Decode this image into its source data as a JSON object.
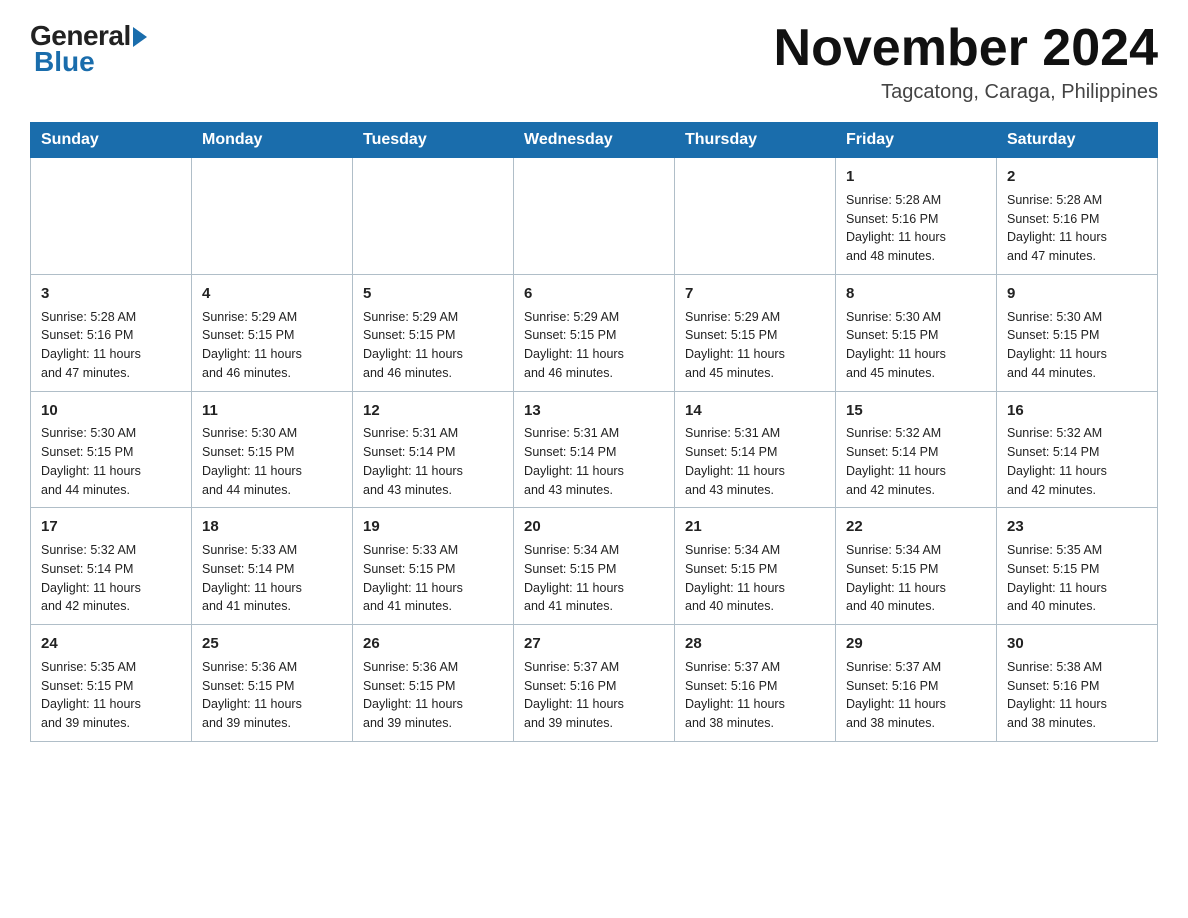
{
  "header": {
    "logo_general": "General",
    "logo_blue": "Blue",
    "month_title": "November 2024",
    "location": "Tagcatong, Caraga, Philippines"
  },
  "weekdays": [
    "Sunday",
    "Monday",
    "Tuesday",
    "Wednesday",
    "Thursday",
    "Friday",
    "Saturday"
  ],
  "weeks": [
    [
      {
        "day": "",
        "info": ""
      },
      {
        "day": "",
        "info": ""
      },
      {
        "day": "",
        "info": ""
      },
      {
        "day": "",
        "info": ""
      },
      {
        "day": "",
        "info": ""
      },
      {
        "day": "1",
        "info": "Sunrise: 5:28 AM\nSunset: 5:16 PM\nDaylight: 11 hours\nand 48 minutes."
      },
      {
        "day": "2",
        "info": "Sunrise: 5:28 AM\nSunset: 5:16 PM\nDaylight: 11 hours\nand 47 minutes."
      }
    ],
    [
      {
        "day": "3",
        "info": "Sunrise: 5:28 AM\nSunset: 5:16 PM\nDaylight: 11 hours\nand 47 minutes."
      },
      {
        "day": "4",
        "info": "Sunrise: 5:29 AM\nSunset: 5:15 PM\nDaylight: 11 hours\nand 46 minutes."
      },
      {
        "day": "5",
        "info": "Sunrise: 5:29 AM\nSunset: 5:15 PM\nDaylight: 11 hours\nand 46 minutes."
      },
      {
        "day": "6",
        "info": "Sunrise: 5:29 AM\nSunset: 5:15 PM\nDaylight: 11 hours\nand 46 minutes."
      },
      {
        "day": "7",
        "info": "Sunrise: 5:29 AM\nSunset: 5:15 PM\nDaylight: 11 hours\nand 45 minutes."
      },
      {
        "day": "8",
        "info": "Sunrise: 5:30 AM\nSunset: 5:15 PM\nDaylight: 11 hours\nand 45 minutes."
      },
      {
        "day": "9",
        "info": "Sunrise: 5:30 AM\nSunset: 5:15 PM\nDaylight: 11 hours\nand 44 minutes."
      }
    ],
    [
      {
        "day": "10",
        "info": "Sunrise: 5:30 AM\nSunset: 5:15 PM\nDaylight: 11 hours\nand 44 minutes."
      },
      {
        "day": "11",
        "info": "Sunrise: 5:30 AM\nSunset: 5:15 PM\nDaylight: 11 hours\nand 44 minutes."
      },
      {
        "day": "12",
        "info": "Sunrise: 5:31 AM\nSunset: 5:14 PM\nDaylight: 11 hours\nand 43 minutes."
      },
      {
        "day": "13",
        "info": "Sunrise: 5:31 AM\nSunset: 5:14 PM\nDaylight: 11 hours\nand 43 minutes."
      },
      {
        "day": "14",
        "info": "Sunrise: 5:31 AM\nSunset: 5:14 PM\nDaylight: 11 hours\nand 43 minutes."
      },
      {
        "day": "15",
        "info": "Sunrise: 5:32 AM\nSunset: 5:14 PM\nDaylight: 11 hours\nand 42 minutes."
      },
      {
        "day": "16",
        "info": "Sunrise: 5:32 AM\nSunset: 5:14 PM\nDaylight: 11 hours\nand 42 minutes."
      }
    ],
    [
      {
        "day": "17",
        "info": "Sunrise: 5:32 AM\nSunset: 5:14 PM\nDaylight: 11 hours\nand 42 minutes."
      },
      {
        "day": "18",
        "info": "Sunrise: 5:33 AM\nSunset: 5:14 PM\nDaylight: 11 hours\nand 41 minutes."
      },
      {
        "day": "19",
        "info": "Sunrise: 5:33 AM\nSunset: 5:15 PM\nDaylight: 11 hours\nand 41 minutes."
      },
      {
        "day": "20",
        "info": "Sunrise: 5:34 AM\nSunset: 5:15 PM\nDaylight: 11 hours\nand 41 minutes."
      },
      {
        "day": "21",
        "info": "Sunrise: 5:34 AM\nSunset: 5:15 PM\nDaylight: 11 hours\nand 40 minutes."
      },
      {
        "day": "22",
        "info": "Sunrise: 5:34 AM\nSunset: 5:15 PM\nDaylight: 11 hours\nand 40 minutes."
      },
      {
        "day": "23",
        "info": "Sunrise: 5:35 AM\nSunset: 5:15 PM\nDaylight: 11 hours\nand 40 minutes."
      }
    ],
    [
      {
        "day": "24",
        "info": "Sunrise: 5:35 AM\nSunset: 5:15 PM\nDaylight: 11 hours\nand 39 minutes."
      },
      {
        "day": "25",
        "info": "Sunrise: 5:36 AM\nSunset: 5:15 PM\nDaylight: 11 hours\nand 39 minutes."
      },
      {
        "day": "26",
        "info": "Sunrise: 5:36 AM\nSunset: 5:15 PM\nDaylight: 11 hours\nand 39 minutes."
      },
      {
        "day": "27",
        "info": "Sunrise: 5:37 AM\nSunset: 5:16 PM\nDaylight: 11 hours\nand 39 minutes."
      },
      {
        "day": "28",
        "info": "Sunrise: 5:37 AM\nSunset: 5:16 PM\nDaylight: 11 hours\nand 38 minutes."
      },
      {
        "day": "29",
        "info": "Sunrise: 5:37 AM\nSunset: 5:16 PM\nDaylight: 11 hours\nand 38 minutes."
      },
      {
        "day": "30",
        "info": "Sunrise: 5:38 AM\nSunset: 5:16 PM\nDaylight: 11 hours\nand 38 minutes."
      }
    ]
  ]
}
